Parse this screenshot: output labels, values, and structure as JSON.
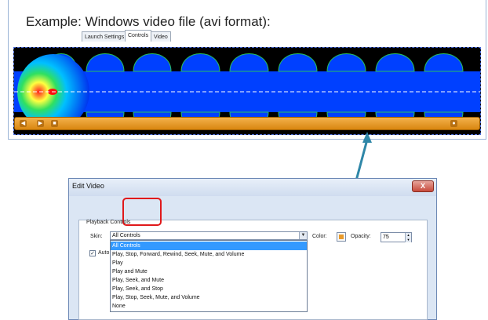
{
  "heading": "Example: Windows video file (avi format):",
  "video": {
    "player_bar": {
      "left_buttons": [
        "◀",
        "▶",
        "■"
      ],
      "right_button": "●"
    }
  },
  "dialog": {
    "title": "Edit Video",
    "close_label": "X",
    "tabs": [
      {
        "label": "Launch Settings",
        "active": false
      },
      {
        "label": "Controls",
        "active": true
      },
      {
        "label": "Video",
        "active": false
      }
    ],
    "group_label": "Playback Controls",
    "skin_label": "Skin:",
    "skin_value": "All Controls",
    "skin_options": [
      "All Controls",
      "Play, Stop, Forward, Rewind, Seek, Mute, and Volume",
      "Play",
      "Play and Mute",
      "Play, Seek, and Mute",
      "Play, Seek, and Stop",
      "Play, Stop, Seek, Mute, and Volume",
      "None"
    ],
    "color_label": "Color:",
    "opacity_label": "Opacity:",
    "opacity_value": "75",
    "autohide_label": "Auto",
    "autohide_checked": true,
    "accent_color": "#e89a2a",
    "highlight_color": "#e0191b"
  }
}
